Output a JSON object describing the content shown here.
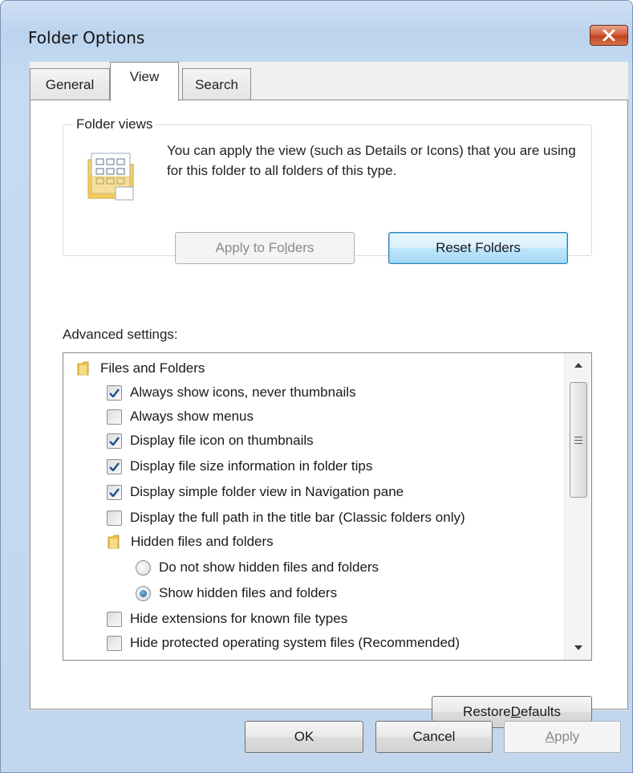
{
  "window": {
    "title": "Folder Options"
  },
  "tabs": [
    {
      "label": "General"
    },
    {
      "label": "View"
    },
    {
      "label": "Search"
    }
  ],
  "folder_views": {
    "legend": "Folder views",
    "description": "You can apply the view (such as Details or Icons) that you are using for this folder to all folders of this type.",
    "apply_button": {
      "pre": "Apply to Fo",
      "accel": "l",
      "post": "ders"
    },
    "reset_button": "Reset Folders"
  },
  "advanced": {
    "label": "Advanced settings:",
    "items": [
      {
        "kind": "folder",
        "label": "Files and Folders"
      },
      {
        "kind": "checkbox",
        "checked": true,
        "label": "Always show icons, never thumbnails"
      },
      {
        "kind": "checkbox",
        "checked": false,
        "label": "Always show menus"
      },
      {
        "kind": "checkbox",
        "checked": true,
        "label": "Display file icon on thumbnails"
      },
      {
        "kind": "checkbox",
        "checked": true,
        "label": "Display file size information in folder tips"
      },
      {
        "kind": "checkbox",
        "checked": true,
        "label": "Display simple folder view in Navigation pane"
      },
      {
        "kind": "checkbox",
        "checked": false,
        "label": "Display the full path in the title bar (Classic folders only)"
      },
      {
        "kind": "folder",
        "label": "Hidden files and folders"
      },
      {
        "kind": "radio",
        "checked": false,
        "label": "Do not show hidden files and folders"
      },
      {
        "kind": "radio",
        "checked": true,
        "label": "Show hidden files and folders"
      },
      {
        "kind": "checkbox",
        "checked": false,
        "label": "Hide extensions for known file types"
      },
      {
        "kind": "checkbox",
        "checked": false,
        "label": "Hide protected operating system files (Recommended)"
      }
    ]
  },
  "restore_button": {
    "pre": "Restore ",
    "accel": "D",
    "post": "efaults"
  },
  "footer": {
    "ok": "OK",
    "cancel": "Cancel",
    "apply": {
      "pre": "",
      "accel": "A",
      "post": "pply"
    }
  },
  "colors": {
    "frame": "#c2d6ee",
    "checkmark": "#1e4f92",
    "folder": "#f0c24a"
  }
}
